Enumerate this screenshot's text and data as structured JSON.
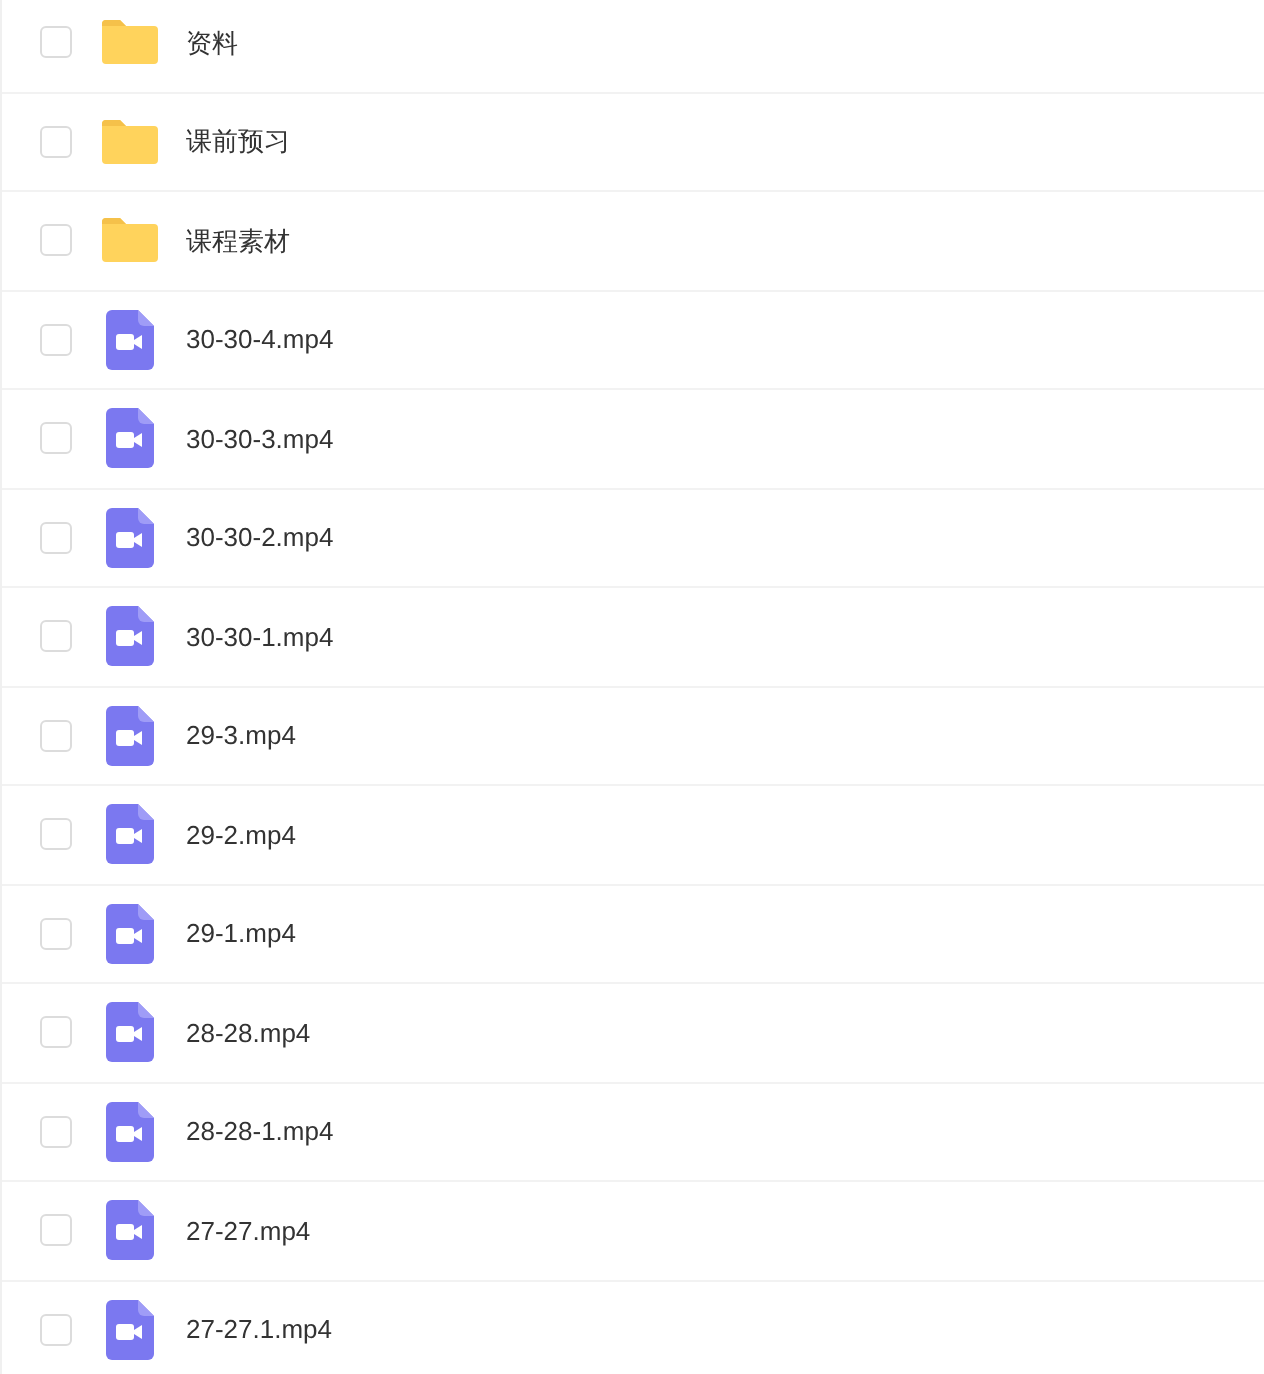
{
  "files": [
    {
      "kind": "folder",
      "name": "资料",
      "checked": false
    },
    {
      "kind": "folder",
      "name": "课前预习",
      "checked": false
    },
    {
      "kind": "folder",
      "name": "课程素材",
      "checked": false
    },
    {
      "kind": "video",
      "name": "30-30-4.mp4",
      "checked": false
    },
    {
      "kind": "video",
      "name": "30-30-3.mp4",
      "checked": false
    },
    {
      "kind": "video",
      "name": "30-30-2.mp4",
      "checked": false
    },
    {
      "kind": "video",
      "name": "30-30-1.mp4",
      "checked": false
    },
    {
      "kind": "video",
      "name": "29-3.mp4",
      "checked": false
    },
    {
      "kind": "video",
      "name": "29-2.mp4",
      "checked": false
    },
    {
      "kind": "video",
      "name": "29-1.mp4",
      "checked": false
    },
    {
      "kind": "video",
      "name": "28-28.mp4",
      "checked": false
    },
    {
      "kind": "video",
      "name": "28-28-1.mp4",
      "checked": false
    },
    {
      "kind": "video",
      "name": "27-27.mp4",
      "checked": false
    },
    {
      "kind": "video",
      "name": "27-27.1.mp4",
      "checked": false
    }
  ]
}
